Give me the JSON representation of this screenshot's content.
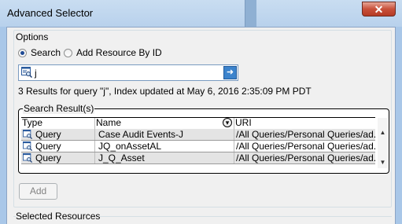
{
  "window": {
    "title": "Advanced Selector",
    "close_label": "✕"
  },
  "options": {
    "title": "Options",
    "radio_search": "Search",
    "radio_add_by_id": "Add Resource By ID",
    "selected": "search"
  },
  "search": {
    "value": "j",
    "go_icon": "arrow-right-icon"
  },
  "status": "3 Results for query \"j\", Index updated at May 6, 2016 2:35:09 PM PDT",
  "results": {
    "title": "Search Result(s)",
    "columns": [
      "Type",
      "Name",
      "URI"
    ],
    "rows": [
      {
        "type": "Query",
        "name": "Case Audit Events-J",
        "uri": "/All Queries/Personal Queries/ad..."
      },
      {
        "type": "Query",
        "name": "JQ_onAssetAL",
        "uri": "/All Queries/Personal Queries/ad..."
      },
      {
        "type": "Query",
        "name": "J_Q_Asset",
        "uri": "/All Queries/Personal Queries/ad..."
      }
    ]
  },
  "add_label": "Add",
  "selected_resources_title": "Selected Resources"
}
